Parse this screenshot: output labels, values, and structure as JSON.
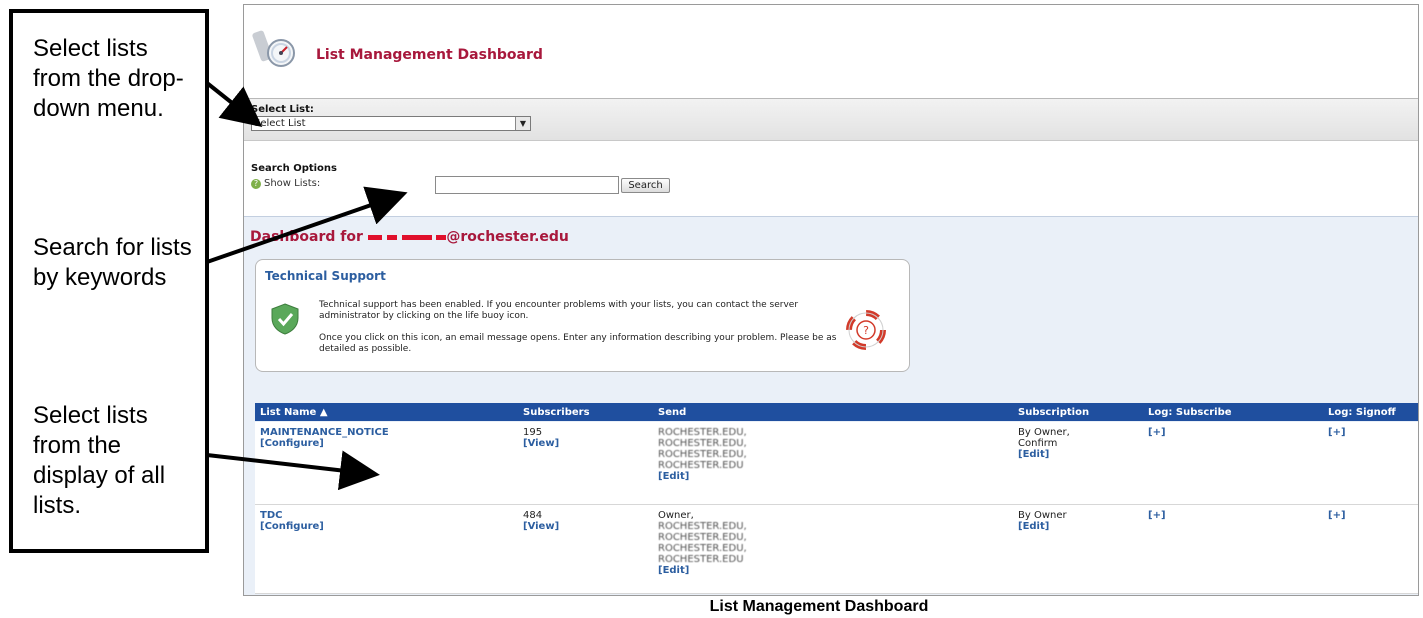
{
  "annotations": {
    "note_1": "Select lists from the drop-down menu.",
    "note_2": "Search for lists by keywords",
    "note_3": "Select lists from the display of all lists."
  },
  "header": {
    "title": "List Management Dashboard"
  },
  "select_list": {
    "label": "Select List:",
    "value": "Select List"
  },
  "search": {
    "heading": "Search Options",
    "show_lists_label": "Show Lists:",
    "input_value": "",
    "button_label": "Search"
  },
  "dashboard": {
    "title_prefix": "Dashboard for",
    "title_suffix": "@rochester.edu"
  },
  "tech_support": {
    "title": "Technical Support",
    "para1": "Technical support has been enabled. If you encounter problems with your lists, you can contact the server administrator by clicking on the life buoy icon.",
    "para2": "Once you click on this icon, an email message opens. Enter any information describing your problem. Please be as detailed as possible."
  },
  "table": {
    "headers": [
      "List Name ▲",
      "Subscribers",
      "Send",
      "Subscription",
      "Log: Subscribe",
      "Log: Signoff"
    ],
    "rows": [
      {
        "name": "MAINTENANCE_NOTICE",
        "configure": "[Configure]",
        "subscribers": "195",
        "view": "[View]",
        "send": [
          "ROCHESTER.EDU,",
          "ROCHESTER.EDU,",
          "ROCHESTER.EDU,",
          "ROCHESTER.EDU"
        ],
        "send_edit": "[Edit]",
        "subscription": [
          "By Owner,",
          "Confirm"
        ],
        "subscription_edit": "[Edit]",
        "log_subscribe": "[+]",
        "log_signoff": "[+]"
      },
      {
        "name": "TDC",
        "configure": "[Configure]",
        "subscribers": "484",
        "view": "[View]",
        "send": [
          "Owner,",
          "ROCHESTER.EDU,",
          "ROCHESTER.EDU,",
          "ROCHESTER.EDU,",
          "ROCHESTER.EDU"
        ],
        "send_edit": "[Edit]",
        "subscription": [
          "By Owner"
        ],
        "subscription_edit": "[Edit]",
        "log_subscribe": "[+]",
        "log_signoff": "[+]"
      }
    ]
  },
  "caption": "List Management Dashboard",
  "colors": {
    "brand": "#a8183c",
    "link": "#2c5ea0",
    "table_header": "#1f4f9f"
  },
  "icons": [
    "dashboard-gauge-icon",
    "help-icon",
    "shield-check-icon",
    "life-buoy-icon",
    "dropdown-arrow-icon"
  ]
}
